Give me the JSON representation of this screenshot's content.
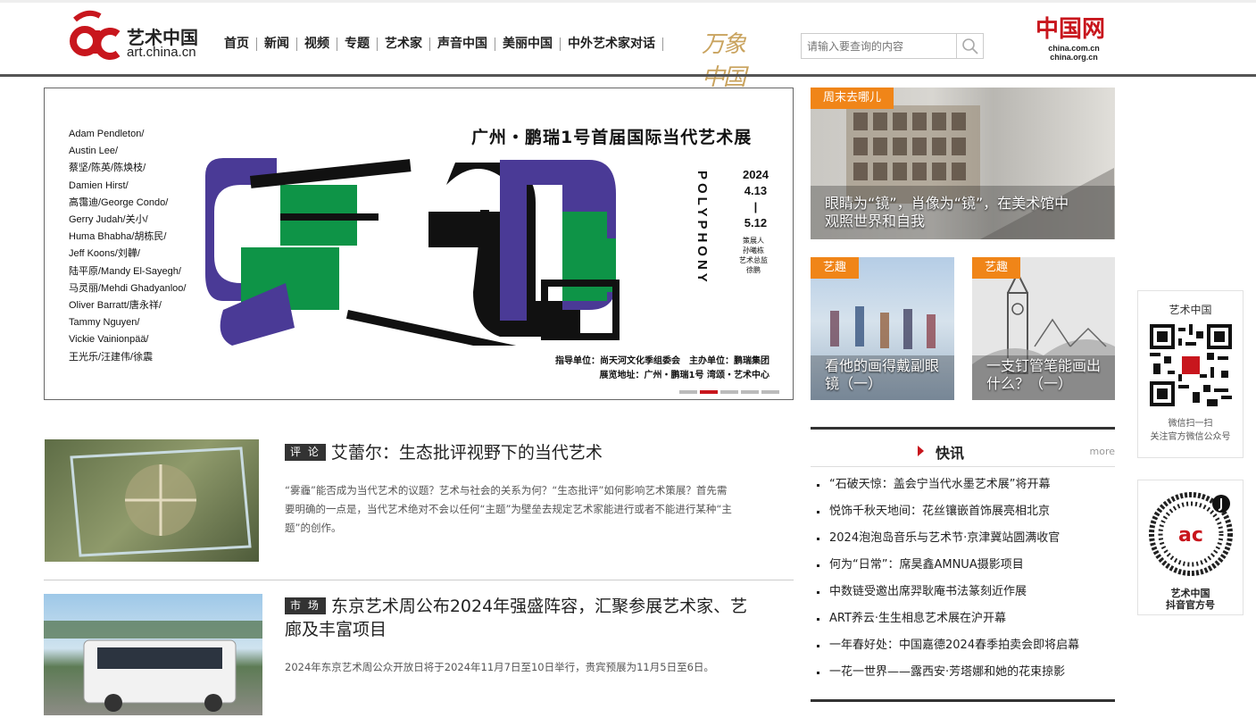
{
  "header": {
    "logo_cn": "艺术中国",
    "logo_en": "art.china.cn",
    "nav": [
      "首页",
      "新闻",
      "视频",
      "专题",
      "艺术家",
      "声音中国",
      "美丽中国",
      "中外艺术家对话"
    ],
    "wanxiang": "万象中国",
    "search_placeholder": "请输入要查询的内容",
    "china_logo": "中国网",
    "china_domains": [
      "china.com.cn",
      "china.org.cn"
    ]
  },
  "banner": {
    "title": "广州・鹏瑞1号首届国际当代艺术展",
    "artists": [
      "Adam Pendleton/",
      "Austin Lee/",
      "蔡坚/陈英/陈焕枝/",
      "Damien Hirst/",
      "高霭迪/George Condo/",
      "Gerry Judah/关小/",
      "Huma Bhabha/胡栋民/",
      "Jeff Koons/刘韡/",
      "陆平原/Mandy El-Sayegh/",
      "马灵丽/Mehdi Ghadyanloo/",
      "Oliver Barratt/唐永祥/",
      "Tammy Nguyen/",
      "Vickie Vainionpää/",
      "王光乐/汪建伟/徐震"
    ],
    "poly": "POLYPHONY",
    "dates": [
      "2024",
      "4.13",
      "|",
      "5.12"
    ],
    "small": [
      "策展人",
      "孙曦栋",
      "艺术总监",
      "徐鹏"
    ],
    "footer": [
      "指导单位：尚天河文化季组委会　主办单位：鹏瑞集团",
      "展览地址：广州・鹏瑞1号 湾颂・艺术中心"
    ],
    "dots": 5,
    "active_dot": 2
  },
  "features": [
    {
      "tag": "周末去哪儿",
      "caption": [
        "眼睛为“镜”，肖像为“镜”，在美术馆中",
        "观照世界和自我"
      ]
    },
    {
      "tag": "艺趣",
      "caption": [
        "看他的画得戴副眼",
        "镜（一）"
      ]
    },
    {
      "tag": "艺趣",
      "caption": [
        "一支钉管笔能画出",
        "什么？（一）"
      ]
    }
  ],
  "articles": [
    {
      "label": "评 论",
      "title": "艾蕾尔：生态批评视野下的当代艺术",
      "summary": [
        "“雾霾”能否成为当代艺术的议题？艺术与社会的关系为何？“生态批评”如何影响艺术策展？首先需",
        "要明确的一点是，当代艺术绝对不会以任何“主题”为壁垒去规定艺术家能进行或者不能进行某种“主",
        "题”的创作。"
      ]
    },
    {
      "label": "市 场",
      "title": [
        "东京艺术周公布2024年强盛阵容，汇聚参展艺术家、艺",
        "廊及丰富项目"
      ],
      "summary": [
        "2024年东京艺术周公众开放日将于2024年11月7日至10日举行，贵宾预展为11月5日至6日。"
      ]
    }
  ],
  "kuaixun": {
    "title": "快讯",
    "more": "more",
    "items": [
      "“石破天惊：盖会宁当代水墨艺术展”将开幕",
      "悦饰千秋天地间：花丝镶嵌首饰展亮相北京",
      "2024泡泡岛音乐与艺术节·京津冀站圆满收官",
      "何为“日常”：席昊鑫AMNUA摄影项目",
      "中数链受邀出席羿耿庵书法篆刻近作展",
      "ART养云·生生相息艺术展在沪开幕",
      "一年春好处：中国嘉德2024春季拍卖会即将启幕",
      "一花一世界——露西安·芳塔娜和她的花束掠影"
    ]
  },
  "qr": {
    "wechat_title": "艺术中国",
    "wechat_caption": [
      "微信扫一扫",
      "关注官方微信公众号"
    ],
    "douyin_caption": [
      "艺术中国",
      "抖音官方号"
    ]
  },
  "colors": {
    "brand_red": "#c8161d",
    "tag_orange": "#f08518"
  }
}
